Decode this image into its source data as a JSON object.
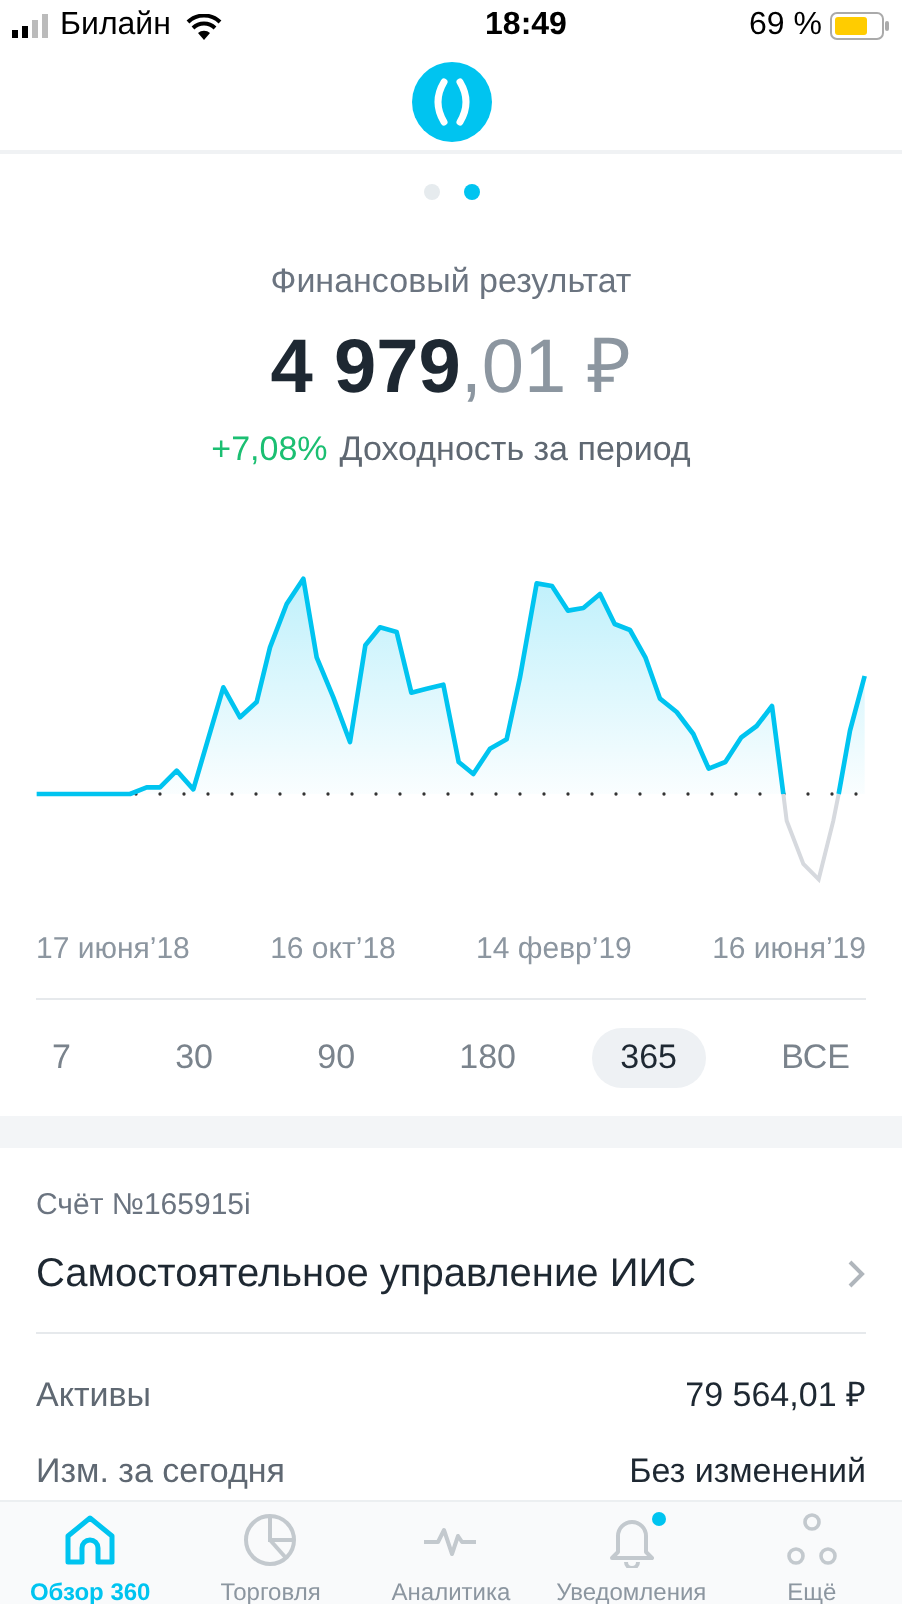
{
  "status_bar": {
    "carrier": "Билайн",
    "time": "18:49",
    "battery": "69 %"
  },
  "pager": [
    {
      "selected": false
    },
    {
      "selected": true
    }
  ],
  "summary": {
    "title": "Финансовый результат",
    "amount_integer": "4 979",
    "amount_fraction": ",01 ₽",
    "change": "+7,08%",
    "change_label": "Доходность за период"
  },
  "chart": {
    "x_labels": [
      "17 июня’18",
      "16 окт’18",
      "14 февр’19",
      "16 июня’19"
    ]
  },
  "periods": [
    {
      "label": "7",
      "selected": false
    },
    {
      "label": "30",
      "selected": false
    },
    {
      "label": "90",
      "selected": false
    },
    {
      "label": "180",
      "selected": false
    },
    {
      "label": "365",
      "selected": true
    },
    {
      "label": "ВСЕ",
      "selected": false
    }
  ],
  "account": {
    "number": "Счёт №165915i",
    "name": "Самостоятельное управление ИИС",
    "rows": [
      {
        "label": "Активы",
        "value": "79 564,01 ₽"
      },
      {
        "label": "Изм. за сегодня",
        "value": "Без изменений"
      }
    ]
  },
  "tab_bar": [
    {
      "kind": "home",
      "label": "Обзор 360",
      "selected": true,
      "badge": false
    },
    {
      "kind": "pie",
      "label": "Торговля",
      "selected": false,
      "badge": false
    },
    {
      "kind": "pulse",
      "label": "Аналитика",
      "selected": false,
      "badge": false
    },
    {
      "kind": "bell",
      "label": "Уведомления",
      "selected": false,
      "badge": true
    },
    {
      "kind": "dots",
      "label": "Ещё",
      "selected": false,
      "badge": false
    }
  ]
}
